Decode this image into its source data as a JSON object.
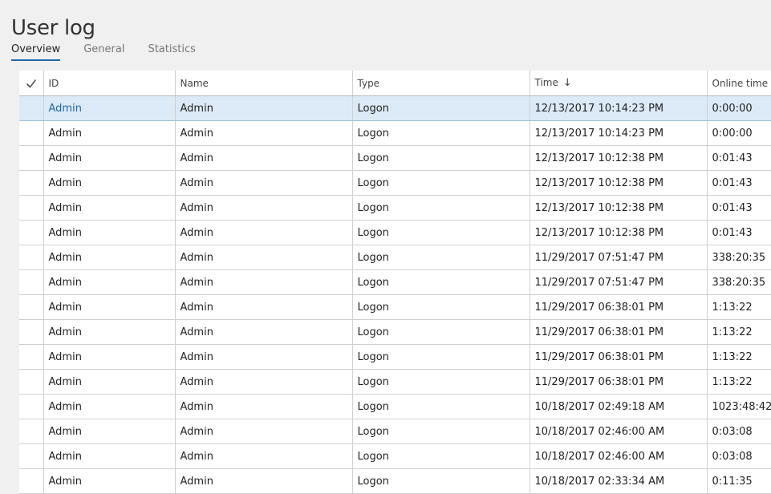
{
  "page": {
    "title": "User log"
  },
  "tabs": [
    {
      "label": "Overview",
      "active": true
    },
    {
      "label": "General",
      "active": false
    },
    {
      "label": "Statistics",
      "active": false
    }
  ],
  "grid": {
    "columns": {
      "id": "ID",
      "name": "Name",
      "type": "Type",
      "time": "Time",
      "online": "Online time"
    },
    "sort_icon": "arrow-down-icon",
    "select_icon": "checkmark-icon",
    "rows": [
      {
        "id": "Admin",
        "name": "Admin",
        "type": "Logon",
        "time": "12/13/2017 10:14:23 PM",
        "online": "0:00:00"
      },
      {
        "id": "Admin",
        "name": "Admin",
        "type": "Logon",
        "time": "12/13/2017 10:14:23 PM",
        "online": "0:00:00"
      },
      {
        "id": "Admin",
        "name": "Admin",
        "type": "Logon",
        "time": "12/13/2017 10:12:38 PM",
        "online": "0:01:43"
      },
      {
        "id": "Admin",
        "name": "Admin",
        "type": "Logon",
        "time": "12/13/2017 10:12:38 PM",
        "online": "0:01:43"
      },
      {
        "id": "Admin",
        "name": "Admin",
        "type": "Logon",
        "time": "12/13/2017 10:12:38 PM",
        "online": "0:01:43"
      },
      {
        "id": "Admin",
        "name": "Admin",
        "type": "Logon",
        "time": "12/13/2017 10:12:38 PM",
        "online": "0:01:43"
      },
      {
        "id": "Admin",
        "name": "Admin",
        "type": "Logon",
        "time": "11/29/2017 07:51:47 PM",
        "online": "338:20:35"
      },
      {
        "id": "Admin",
        "name": "Admin",
        "type": "Logon",
        "time": "11/29/2017 07:51:47 PM",
        "online": "338:20:35"
      },
      {
        "id": "Admin",
        "name": "Admin",
        "type": "Logon",
        "time": "11/29/2017 06:38:01 PM",
        "online": "1:13:22"
      },
      {
        "id": "Admin",
        "name": "Admin",
        "type": "Logon",
        "time": "11/29/2017 06:38:01 PM",
        "online": "1:13:22"
      },
      {
        "id": "Admin",
        "name": "Admin",
        "type": "Logon",
        "time": "11/29/2017 06:38:01 PM",
        "online": "1:13:22"
      },
      {
        "id": "Admin",
        "name": "Admin",
        "type": "Logon",
        "time": "11/29/2017 06:38:01 PM",
        "online": "1:13:22"
      },
      {
        "id": "Admin",
        "name": "Admin",
        "type": "Logon",
        "time": "10/18/2017 02:49:18 AM",
        "online": "1023:48:42"
      },
      {
        "id": "Admin",
        "name": "Admin",
        "type": "Logon",
        "time": "10/18/2017 02:46:00 AM",
        "online": "0:03:08"
      },
      {
        "id": "Admin",
        "name": "Admin",
        "type": "Logon",
        "time": "10/18/2017 02:46:00 AM",
        "online": "0:03:08"
      },
      {
        "id": "Admin",
        "name": "Admin",
        "type": "Logon",
        "time": "10/18/2017 02:33:34 AM",
        "online": "0:11:35"
      }
    ],
    "selected_row": 0
  },
  "colors": {
    "accent": "#1f69a8",
    "selected_row_bg": "#dce9f7",
    "page_bg": "#f0f0f0"
  }
}
